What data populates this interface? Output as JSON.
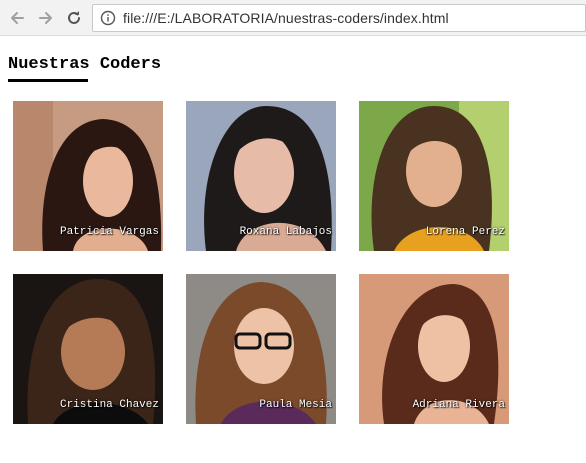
{
  "browser": {
    "back_icon": "arrow-left-icon",
    "forward_icon": "arrow-right-icon",
    "reload_icon": "reload-icon",
    "info_icon": "info-icon",
    "url": "file:///E:/LABORATORIA/nuestras-coders/index.html"
  },
  "page": {
    "title": "Nuestras Coders"
  },
  "coders": [
    {
      "name": "Patricia Vargas"
    },
    {
      "name": "Roxana Labajos"
    },
    {
      "name": "Lorena Perez"
    },
    {
      "name": "Cristina Chavez"
    },
    {
      "name": "Paula Mesia"
    },
    {
      "name": "Adriana Rivera"
    }
  ]
}
